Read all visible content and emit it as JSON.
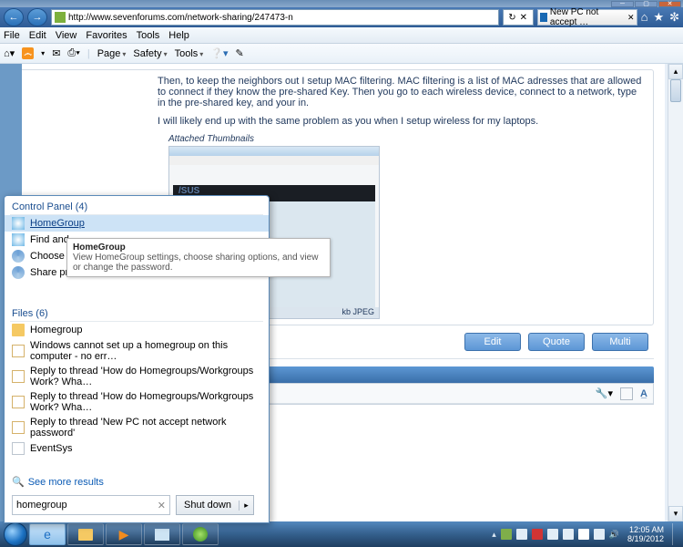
{
  "window": {
    "min": "─",
    "max": "▢",
    "close": "✕"
  },
  "nav": {
    "url": "http://www.sevenforums.com/network-sharing/247473-n",
    "tab": "New PC not accept …",
    "icons": {
      "home": "⌂",
      "star": "★",
      "gear": "✼"
    }
  },
  "menubar": [
    "File",
    "Edit",
    "View",
    "Favorites",
    "Tools",
    "Help"
  ],
  "cmdbar": {
    "page": "Page",
    "safety": "Safety",
    "tools": "Tools"
  },
  "post": {
    "p1": "Then, to keep the neighbors out I setup MAC filtering. MAC filtering is a list of MAC adresses that are allowed to connect if they know the pre-shared Key. Then you go to each wireless device, connect to a network, type in the pre-shared key, and your in.",
    "p2": "I will likely end up with the same problem as you when I setup wireless for my laptops.",
    "attach": "Attached Thumbnails",
    "thumb_caption": "kb  JPEG",
    "asus": "/SUS"
  },
  "buttons": {
    "edit": "Edit",
    "quote": "Quote",
    "multi": "Multi"
  },
  "startmenu": {
    "cp_header": "Control Panel (4)",
    "cp": [
      "HomeGroup",
      "Find and",
      "Choose h",
      "Share pri"
    ],
    "files_header": "Files (6)",
    "files": [
      "Homegroup",
      "Windows cannot set up a homegroup on this computer - no err…",
      "Reply to thread 'How do Homegroups/Workgroups Work? Wha…",
      "Reply to thread 'How do Homegroups/Workgroups Work? Wha…",
      "Reply to thread 'New PC not accept network password'",
      "EventSys"
    ],
    "more": "See more results",
    "search": "homegroup",
    "shutdown": "Shut down"
  },
  "tooltip": {
    "title": "HomeGroup",
    "body": "View HomeGroup settings, choose sharing options, and view or change the password."
  },
  "clock": {
    "time": "12:05 AM",
    "date": "8/19/2012"
  }
}
